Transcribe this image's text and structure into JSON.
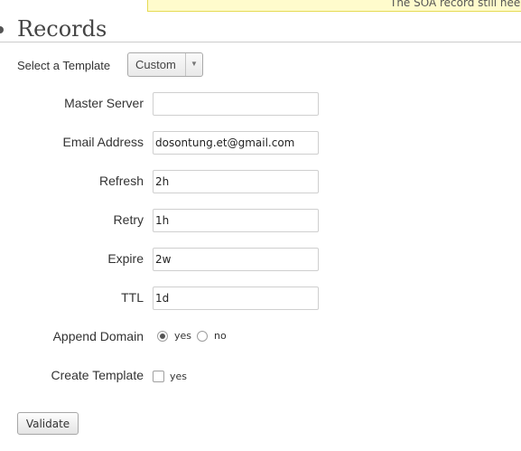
{
  "notice": {
    "text": "The SOA record still nee"
  },
  "section": {
    "title": "Records"
  },
  "template": {
    "label": "Select a Template",
    "selected": "Custom",
    "arrow_icon": "chevron-down-icon"
  },
  "fields": {
    "master_server": {
      "label": "Master Server",
      "value": ""
    },
    "email_address": {
      "label": "Email Address",
      "value": "dosontung.et@gmail.com"
    },
    "refresh": {
      "label": "Refresh",
      "value": "2h"
    },
    "retry": {
      "label": "Retry",
      "value": "1h"
    },
    "expire": {
      "label": "Expire",
      "value": "2w"
    },
    "ttl": {
      "label": "TTL",
      "value": "1d"
    }
  },
  "append_domain": {
    "label": "Append Domain",
    "options": [
      {
        "label": "yes",
        "checked": true
      },
      {
        "label": "no",
        "checked": false
      }
    ]
  },
  "create_template": {
    "label": "Create Template",
    "option_label": "yes",
    "checked": false
  },
  "actions": {
    "validate_label": "Validate"
  }
}
